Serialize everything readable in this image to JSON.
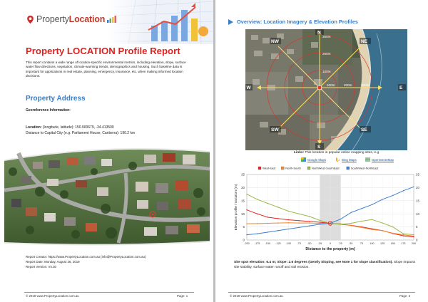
{
  "left_page": {
    "logo": {
      "prefix": "Property",
      "suffix": "Location"
    },
    "title": "Property LOCATION Profile Report",
    "intro": "This report contains a wide range of location-specific environmental metrics, including elevation, slope, surface water flow directions, vegetation, climate-warming trends, demographics and housing. Such baseline data is important for applications in real estate, planning, emergency, insurance, etc. when making informed location decisions.",
    "section_title": "Property Address",
    "georef_label": "Georeference Information:",
    "location_label": "Location:",
    "location_value": " (longitude, latitude): 150.900679, -34.413500",
    "distance_text": "Distance to Capital City (e.g. Parliament House, Canberra): 190.2 km",
    "report_creator": "Report Creator: https://www.PropertyLocation.com.au (info@PropertyLocation.com.au)",
    "report_date": "Report Date: Monday, August 26, 2019",
    "report_version": "Report Version: V4.30",
    "footer_left": "© 2019 www.PropertyLocation.com.au",
    "footer_right": "Page: 1"
  },
  "right_page": {
    "overview_title": "Overview: Location Imagery & Elevation Profiles",
    "map_labels": {
      "n": "N",
      "s": "S",
      "e": "E",
      "w": "W",
      "ne": "NE",
      "nw": "NW",
      "se": "SE",
      "sw": "SW",
      "rings": [
        "300m",
        "200m",
        "100m"
      ]
    },
    "links_bold": "Links:",
    "links_text": " This location in popular online mapping sites, e.g.",
    "links": [
      "Google Maps",
      "Bing Maps",
      "OpenStreetMap"
    ],
    "summary_p1_bold": "Site spot elevation: 6.4 m; Slope: 2.6 degrees (Gently Sloping, see Note 1 for slope classification).",
    "summary_p2": " Slope impacts site stability, surface water runoff and soil erosion.",
    "footer_left": "© 2019 www.PropertyLocation.com.au",
    "footer_right": "Page: 2"
  },
  "chart_data": {
    "type": "line",
    "title": "",
    "xlabel": "Distance to the property (m)",
    "ylabel": "Elevation profile / variation (m)",
    "x": [
      -200,
      -175,
      -150,
      -125,
      -100,
      -75,
      -50,
      -25,
      0,
      25,
      50,
      75,
      100,
      125,
      150,
      175,
      200
    ],
    "xlim": [
      -200,
      200
    ],
    "ylim": [
      0,
      25
    ],
    "yticks": [
      0,
      5,
      10,
      15,
      20,
      25
    ],
    "legend_position": "top",
    "series": [
      {
        "name": "West-East",
        "color": "#e8231c",
        "values": [
          11.5,
          10,
          8.7,
          8.2,
          7.7,
          7.4,
          7.1,
          6.8,
          6.4,
          6.0,
          5.6,
          5.0,
          4.3,
          3.6,
          2.5,
          1.6,
          1.2
        ]
      },
      {
        "name": "North-South",
        "color": "#f08a2c",
        "values": [
          6.2,
          6.3,
          6.4,
          6.5,
          6.6,
          6.5,
          6.5,
          6.4,
          6.4,
          6.2,
          5.5,
          4.8,
          4.0,
          3.6,
          2.6,
          2.0,
          1.5
        ]
      },
      {
        "name": "NorthWest-SouthEast",
        "color": "#9ab84a",
        "values": [
          17.5,
          15.5,
          14,
          12.5,
          11,
          10,
          9,
          7.5,
          6.4,
          6.0,
          6.4,
          7.2,
          7.8,
          6.5,
          5.0,
          2.4,
          2.0
        ]
      },
      {
        "name": "SouthWest-NorthEast",
        "color": "#3f7fd0",
        "values": [
          2.0,
          2.4,
          3.0,
          3.6,
          4.2,
          4.8,
          5.4,
          6.0,
          6.4,
          8.0,
          10.5,
          12.0,
          13.5,
          15.5,
          17,
          18.8,
          20.3
        ]
      }
    ]
  }
}
